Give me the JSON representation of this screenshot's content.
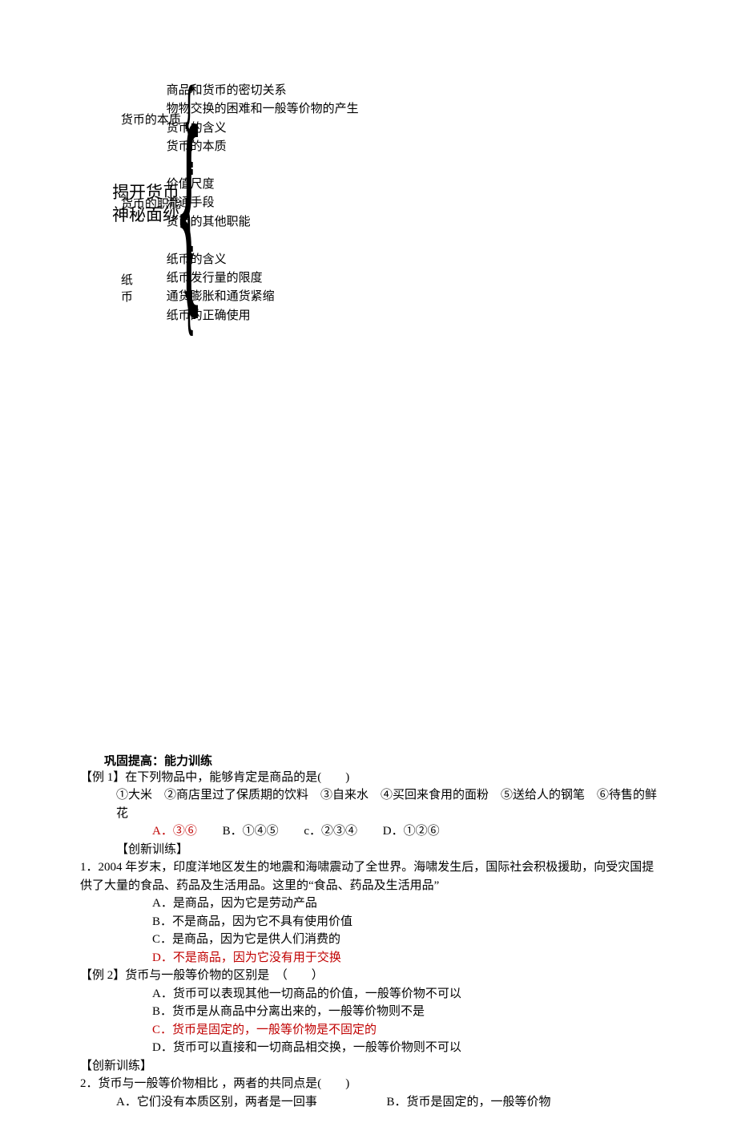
{
  "diagram": {
    "root": "揭开货币神秘面纱",
    "branches": [
      {
        "label": "货币的本质",
        "items": [
          "商品和货币的密切关系",
          "物物交换的困难和一般等价物的产生",
          "货币的含义",
          "货币的本质"
        ]
      },
      {
        "label": "货币的职能",
        "items": [
          "价值尺度",
          "流通手段",
          "货币的其他职能"
        ]
      },
      {
        "label": "纸　币",
        "items": [
          "纸币的含义",
          "纸币发行量的限度",
          "通货膨胀和通货紧缩",
          "纸币的正确使用"
        ]
      }
    ]
  },
  "sections": {
    "ability_title": "巩固提高：能力训练",
    "ex1": {
      "stem": "【例 1】在下列物品中，能够肯定是商品的是(　　)",
      "items_line": "①大米　②商店里过了保质期的饮料　③自来水　④买回来食用的面粉　⑤送给人的钢笔　⑥待售的鲜花",
      "opts": {
        "A": "A．③⑥",
        "B": "B．①④⑤",
        "C": "c．②③④",
        "D": "D．①②⑥"
      }
    },
    "training_label": "【创新训练】",
    "q1": {
      "stem": "1．2004 年岁末，印度洋地区发生的地震和海啸震动了全世界。海啸发生后，国际社会积极援助，向受灾国提供了大量的食品、药品及生活用品。这里的“食品、药品及生活用品”",
      "A": "A．是商品，因为它是劳动产品",
      "B": "B．不是商品，因为它不具有使用价值",
      "C": "C．是商品，因为它是供人们消费的",
      "D": "D．不是商品，因为它没有用于交换"
    },
    "ex2": {
      "stem": "【例 2】货币与一般等价物的区别是　（　　）",
      "A": "A．货币可以表现其他一切商品的价值，一般等价物不可以",
      "B": "B．货币是从商品中分离出来的，一般等价物则不是",
      "C": "C．货币是固定的，一般等价物是不固定的",
      "D": "D．货币可以直接和一切商品相交换，一般等价物则不可以"
    },
    "q2": {
      "stem": "2．货币与一般等价物相比 ，两者的共同点是(　　)",
      "A": "A．它们没有本质区别，两者是一回事",
      "B": "B．货币是固定的，一般等价物"
    }
  }
}
